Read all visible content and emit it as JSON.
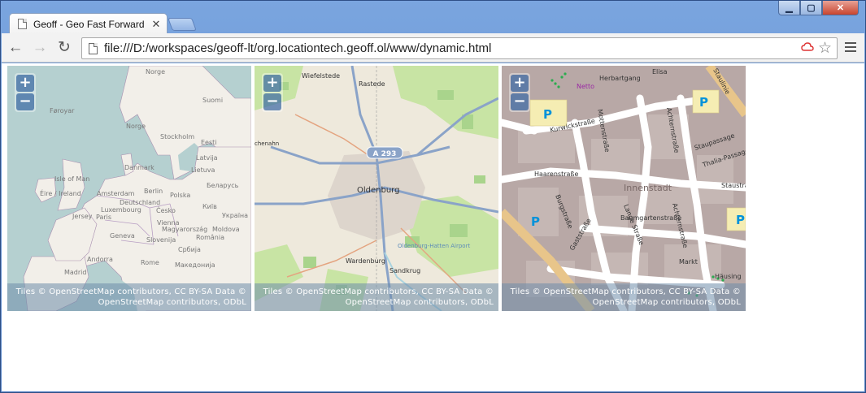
{
  "window": {
    "controls": {
      "minimize": "▁",
      "maximize": "▢",
      "close": "✕"
    }
  },
  "tab": {
    "title": "Geoff - Geo Fast Forward",
    "close": "✕"
  },
  "toolbar": {
    "back": "←",
    "forward": "→",
    "reload": "↻",
    "url": "file:///D:/workspaces/geoff-lt/org.locationtech.geoff.ol/www/dynamic.html",
    "star": "☆"
  },
  "maps": [
    {
      "zoom_in": "+",
      "zoom_out": "−",
      "attribution": "Tiles © OpenStreetMap contributors, CC BY-SA  Data © OpenStreetMap contributors, ODbL",
      "labels": {
        "norge_top": "Norge",
        "suomi": "Suomi",
        "foroyar": "Føroyar",
        "norge": "Norge",
        "stockholm": "Stockholm",
        "eesti": "Eesti",
        "latvija": "Latvija",
        "danmark": "Danmark",
        "lietuva": "Lietuva",
        "isle_of_man": "Isle of Man",
        "ireland": "Éire / Ireland",
        "amsterdam": "Amsterdam",
        "berlin": "Berlin",
        "polska": "Polska",
        "belarus": "Беларусь",
        "deutschland": "Deutschland",
        "jersey": "Jersey",
        "paris": "Paris",
        "luxembourg": "Luxembourg",
        "cesko": "Česko",
        "kiev": "Київ",
        "ukraina": "Україна",
        "vienna": "Vienna",
        "magyarorszag": "Magyarország",
        "moldova": "Moldova",
        "geneva": "Geneva",
        "slovenija": "Slovenija",
        "romania": "România",
        "srbija": "Србија",
        "andorra": "Andorra",
        "madrid": "Madrid",
        "rome": "Rome",
        "makedonija": "Македонија"
      }
    },
    {
      "zoom_in": "+",
      "zoom_out": "−",
      "attribution": "Tiles © OpenStreetMap contributors, CC BY-SA  Data © OpenStreetMap contributors, ODbL",
      "labels": {
        "wiefelstede": "Wiefelstede",
        "rastede": "Rastede",
        "a293": "A 293",
        "oldenburg": "Oldenburg",
        "wardenburg": "Wardenburg",
        "sandkrug": "Sandkrug",
        "airport": "Oldenburg-Hatten Airport",
        "ochenahn": "chenahn"
      }
    },
    {
      "zoom_in": "+",
      "zoom_out": "−",
      "attribution": "Tiles © OpenStreetMap contributors, CC BY-SA  Data © OpenStreetMap contributors, ODbL",
      "labels": {
        "herbartgang": "Herbartgang",
        "netto": "Netto",
        "kurwickstrasse": "Kurwickstraße",
        "haarenstrasse": "Haarenstraße",
        "innenstadt": "Innenstadt",
        "burgstrasse": "Burgstraße",
        "gaststrasse": "Gaststraße",
        "langestrasse": "Lange Straße",
        "baumgartenstrasse": "Baumgartenstraße",
        "achternstrasse": "Achternstraße",
        "markt": "Markt",
        "hausing": "Häusing",
        "staulinie": "Staulinie",
        "staupassage": "Staupassage",
        "thalia": "Thalia-Passage",
        "staustrasse": "Staustraße",
        "elisabeth": "Elisa",
        "p": "P",
        "mottenstrasse": "Mottenstraße"
      }
    }
  ]
}
